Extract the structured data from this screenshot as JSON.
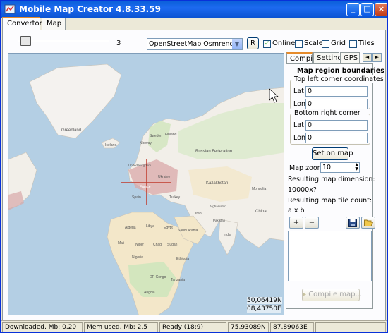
{
  "window": {
    "title": "Mobile Map Creator 4.8.33.59",
    "icons": {
      "app": "app-icon",
      "minimize": "minimize-icon",
      "maximize": "maximize-icon",
      "close": "close-icon"
    },
    "controls": {
      "minimize": "_",
      "maximize": "□",
      "close": "×"
    }
  },
  "main_tabs": [
    {
      "label": "Convertor"
    },
    {
      "label": "Map"
    }
  ],
  "toolbar": {
    "zoom_slider": {
      "value": "3",
      "position": 0.0
    },
    "map_source": "OpenStreetMap Osmrender",
    "refresh_label": "R",
    "checkboxes": [
      {
        "label": "Online",
        "checked": true,
        "mark": "✓"
      },
      {
        "label": "Scale",
        "checked": false,
        "mark": ""
      },
      {
        "label": "Grid",
        "checked": false,
        "mark": ""
      },
      {
        "label": "Tiles",
        "checked": false,
        "mark": ""
      }
    ]
  },
  "map": {
    "coord_lat": "50,06419N",
    "coord_lon": "08,43750E",
    "labels": {
      "greenland": "Greenland",
      "iceland": "Iceland",
      "russian_federation": "Russian Federation",
      "kazakhstan": "Kazakhstan",
      "china": "China",
      "mongolia": "Mongolia",
      "india": "India",
      "algeria": "Algeria",
      "libya": "Libya",
      "egypt": "Egypt",
      "mali": "Mali",
      "niger": "Niger",
      "chad": "Chad",
      "sudan": "Sudan",
      "nigeria": "Nigeria",
      "ethiopia": "Ethiopia",
      "dr_congo": "DR Congo",
      "angola": "Angola",
      "tanzania": "Tanzania",
      "saudi_arabia": "Saudi Arabia",
      "iran": "Iran",
      "turkey": "Turkey",
      "spain": "Spain",
      "france": "France",
      "sweden": "Sweden",
      "norway": "Norway",
      "finland": "Finland",
      "ukraine": "Ukraine",
      "uk": "United Kingdom",
      "pakistan": "Pakistan",
      "afghanistan": "Afghanistan"
    },
    "colors": {
      "ocean": "#b4cfe4",
      "land": "#f2efe9",
      "forest": "#cfe5bc",
      "desert": "#f3e7c9",
      "urban": "#d9a8a8"
    }
  },
  "side_tabs": [
    {
      "label": "Compile"
    },
    {
      "label": "Settings"
    },
    {
      "label": "GPS"
    }
  ],
  "side_tab_arrows": {
    "left": "◄",
    "right": "►"
  },
  "compile": {
    "heading": "Map region boundaries",
    "top_left": {
      "title": "Top left corner coordinates",
      "lat_label": "Lat",
      "lat": "0",
      "lon_label": "Lon",
      "lon": "0"
    },
    "bottom_right": {
      "title": "Bottom right corner",
      "lat_label": "Lat",
      "lat": "0",
      "lon_label": "Lon",
      "lon": "0"
    },
    "set_on_map_label": "Set on map",
    "map_zoom_label": "Map zoom",
    "map_zoom_value": "10",
    "dimension_label": "Resulting map dimension:",
    "dimension_value": "10000x?",
    "tile_count_label": "Resulting map tile count:",
    "tile_count_value": "a x b",
    "add_label": "+",
    "remove_label": "−",
    "save_icon": "save-icon",
    "open_icon": "open-folder-icon",
    "compile_label": "Compile map..."
  },
  "status": {
    "downloaded": "Downloaded, Mb: 0,20",
    "mem_used": "Mem used, Mb: 2,5",
    "ready": "Ready (18:9)",
    "lat": "75,93089N",
    "lon": "87,89063E"
  }
}
